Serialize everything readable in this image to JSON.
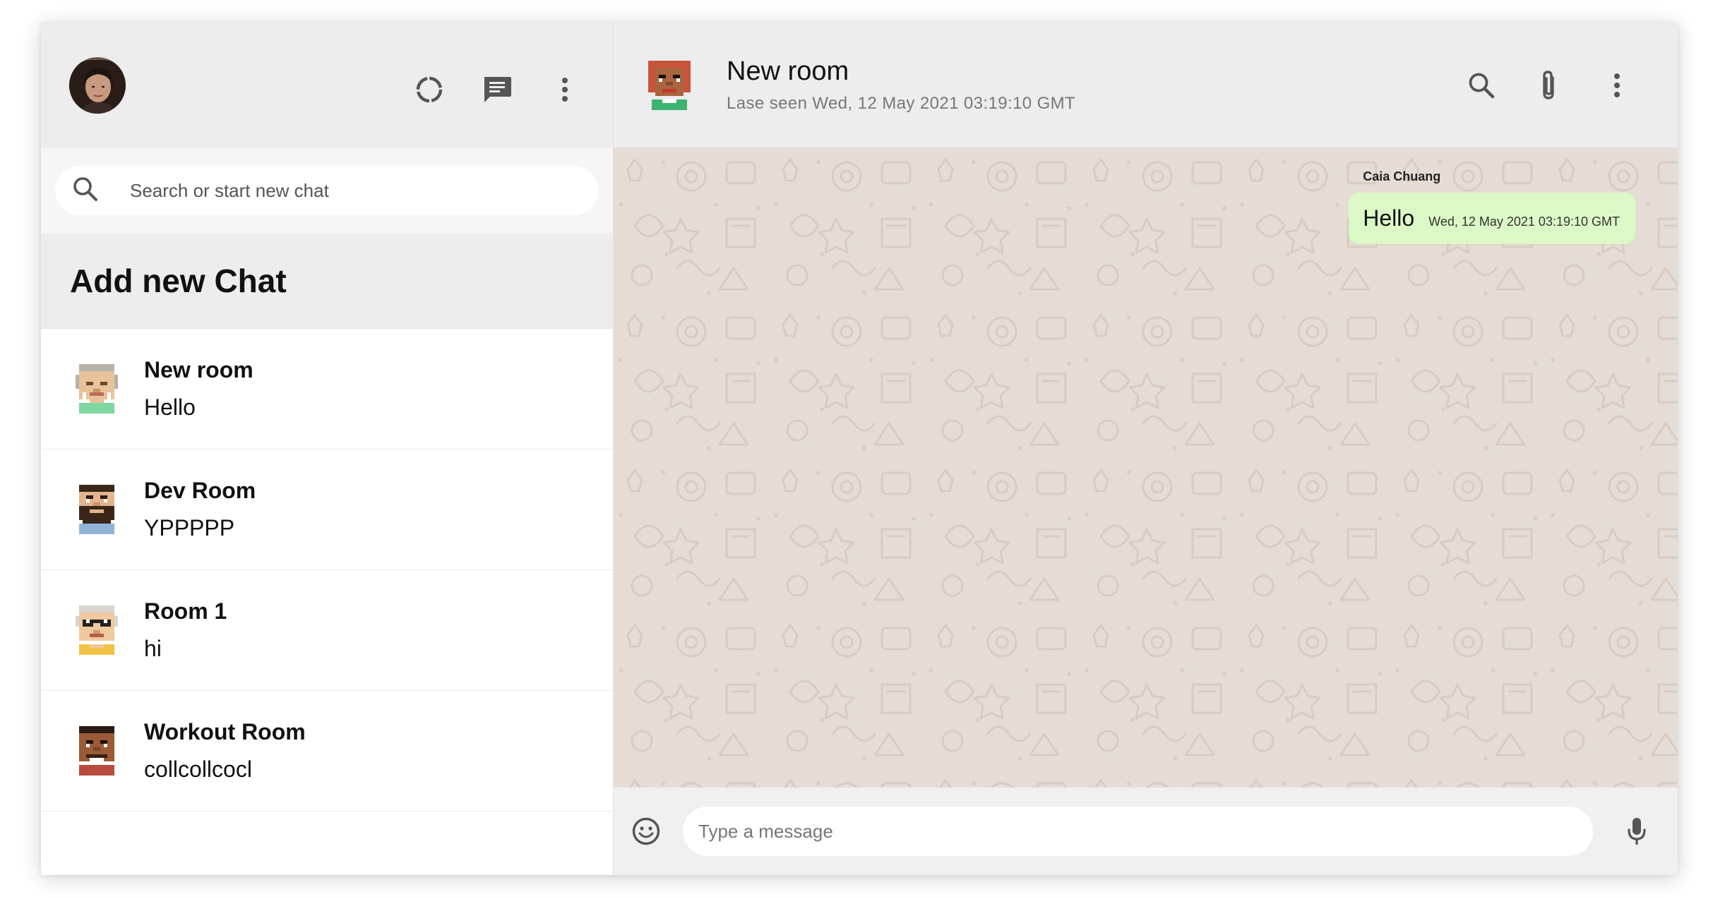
{
  "sidebar": {
    "header": {
      "avatar_icon": "user-avatar-photo",
      "icons": [
        "status-icon",
        "new-chat-icon",
        "more-vertical-icon"
      ]
    },
    "search": {
      "placeholder": "Search or start new chat",
      "value": ""
    },
    "add_chat_label": "Add new Chat",
    "chats": [
      {
        "name": "New room",
        "last_message": "Hello",
        "avatar": "pixel-avatar-grandma"
      },
      {
        "name": "Dev Room",
        "last_message": "YPPPPP",
        "avatar": "pixel-avatar-bearded"
      },
      {
        "name": "Room 1",
        "last_message": "hi",
        "avatar": "pixel-avatar-glasses"
      },
      {
        "name": "Workout Room",
        "last_message": "collcollcocl",
        "avatar": "pixel-avatar-dark"
      }
    ]
  },
  "chat": {
    "header": {
      "title": "New room",
      "last_seen": "Lase seen Wed, 12 May 2021 03:19:10 GMT",
      "avatar": "pixel-avatar-redhead",
      "icons": [
        "search-icon",
        "attach-icon",
        "more-vertical-icon"
      ]
    },
    "messages": [
      {
        "sender": "Caia Chuang",
        "text": "Hello",
        "timestamp": "Wed, 12 May 2021 03:19:10 GMT",
        "sent": true
      }
    ],
    "footer": {
      "placeholder": "Type a message",
      "value": "",
      "icons": [
        "emoji-icon",
        "mic-icon"
      ]
    }
  },
  "colors": {
    "header_bg": "#ededed",
    "chat_bg": "#e5ddd5",
    "bubble_sent": "#dcf8c6",
    "icon_gray": "#555555"
  }
}
